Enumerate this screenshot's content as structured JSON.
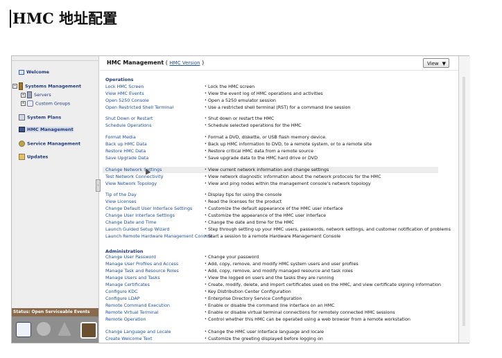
{
  "document": {
    "title": "HMC 地址配置"
  },
  "sidebar": {
    "items": [
      {
        "label": "Welcome"
      },
      {
        "label": "Systems Management"
      },
      {
        "label": "Servers"
      },
      {
        "label": "Custom Groups"
      },
      {
        "label": "System Plans"
      },
      {
        "label": "HMC Management"
      },
      {
        "label": "Service Management"
      },
      {
        "label": "Updates"
      }
    ],
    "status_label": "Status: Open Serviceable Events"
  },
  "main": {
    "header_title": "HMC Management",
    "header_open": "(",
    "header_link": "HMC Version",
    "header_close": ")",
    "view_button": "View"
  },
  "sections": [
    {
      "label": "Operations"
    },
    {
      "label": "Administration"
    }
  ],
  "tasks": [
    {
      "name": "Lock HMC Screen",
      "desc": "Lock the HMC screen"
    },
    {
      "name": "View HMC Events",
      "desc": "View the event log of HMC operations and activities"
    },
    {
      "name": "Open 5250 Console",
      "desc": "Open a 5250 emulator session"
    },
    {
      "name": "Open Restricted Shell Terminal",
      "desc": "Use a restricted shell terminal (RST) for a command line session"
    },
    {
      "name": "Shut Down or Restart",
      "desc": "Shut down or restart the HMC"
    },
    {
      "name": "Schedule Operations",
      "desc": "Schedule selected operations for the HMC"
    },
    {
      "name": "Format Media",
      "desc": "Format a DVD, diskette, or USB flash memory device."
    },
    {
      "name": "Back up HMC Data",
      "desc": "Back up HMC information to DVD, to a remote system, or to a remote site"
    },
    {
      "name": "Restore HMC Data",
      "desc": "Restore critical HMC data from a remote source"
    },
    {
      "name": "Save Upgrade Data",
      "desc": "Save upgrade data to the HMC hard drive or DVD"
    },
    {
      "name": "Change Network Settings",
      "desc": "View current network information and change settings"
    },
    {
      "name": "Test Network Connectivity",
      "desc": "View network diagnostic information about the network protocols for the HMC"
    },
    {
      "name": "View Network Topology",
      "desc": "View and ping nodes within the management console's network topology"
    },
    {
      "name": "Tip of the Day",
      "desc": "Display tips for using the console"
    },
    {
      "name": "View Licenses",
      "desc": "Read the licenses for the product"
    },
    {
      "name": "Change Default User Interface Settings",
      "desc": "Customize the default appearance of the HMC user interface"
    },
    {
      "name": "Change User Interface Settings",
      "desc": "Customize the appearance of the HMC user interface"
    },
    {
      "name": "Change Date and Time",
      "desc": "Change the date and time for the HMC"
    },
    {
      "name": "Launch Guided Setup Wizard",
      "desc": "Step through setting up your HMC users, passwords, network settings, and customer notification of problems"
    },
    {
      "name": "Launch Remote Hardware Management Console",
      "desc": "Start a session to a remote Hardware Management Console"
    },
    {
      "name": "Change User Password",
      "desc": "Change your password"
    },
    {
      "name": "Manage User Profiles and Access",
      "desc": "Add, copy, remove, and modify HMC system users and user profiles"
    },
    {
      "name": "Manage Task and Resource Roles",
      "desc": "Add, copy, remove, and modify managed resource and task roles"
    },
    {
      "name": "Manage Users and Tasks",
      "desc": "View the logged on users and the tasks they are running"
    },
    {
      "name": "Manage Certificates",
      "desc": "Create, modify, delete, and import certificates used on the HMC, and view certificate signing information"
    },
    {
      "name": "Configure KDC",
      "desc": "Key Distribution Center Configuration"
    },
    {
      "name": "Configure LDAP",
      "desc": "Enterprise Directory Service Configuration"
    },
    {
      "name": "Remote Command Execution",
      "desc": "Enable or disable the command line interface on an HMC"
    },
    {
      "name": "Remote Virtual Terminal",
      "desc": "Enable or disable virtual terminal connections for remotely connected HMC sessions"
    },
    {
      "name": "Remote Operation",
      "desc": "Control whether this HMC can be operated using a web browser from a remote workstation"
    },
    {
      "name": "Change Language and Locale",
      "desc": "Change the HMC user interface language and locale"
    },
    {
      "name": "Create Welcome Text",
      "desc": "Customize the greeting displayed before logging on"
    }
  ]
}
